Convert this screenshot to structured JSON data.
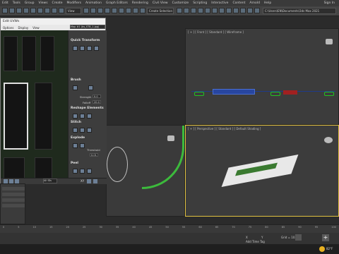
{
  "menu": [
    "Edit",
    "Tools",
    "Group",
    "Views",
    "Create",
    "Modifiers",
    "Animation",
    "Graph Editors",
    "Rendering",
    "Civil View",
    "Customize",
    "Scripting",
    "Interactive",
    "Content",
    "Arnold",
    "Help"
  ],
  "sign_in": "Sign In",
  "toolbar": {
    "view_select": "View",
    "selection_set": "Create Selection Se",
    "project_path": "C:\\Users\\EN\\Documents\\3ds Max 2021"
  },
  "viewports": {
    "front_label": "[ + ] [ Front ] [ Standard ] [ Wireframe ]",
    "perspective_label": "[ + ] [ Perspective ] [ Standard ] [ Default Shading ]"
  },
  "uv_editor": {
    "title": "Edit UVWs",
    "menu": [
      "Options",
      "Display",
      "View"
    ],
    "map_select": "Map #1 (bs_ST8_1.jpg)",
    "map_suffix": "UV",
    "panel": {
      "quick_transform": "Quick Transform",
      "brush": "Brush",
      "strength_label": "Strength",
      "strength_value": "0.0",
      "falloff_label": "Falloff",
      "falloff_value": "20.0",
      "reshape_elements": "Reshape Elements",
      "stitch": "Stitch",
      "explode": "Explode",
      "threshold_label": "Threshold",
      "threshold_value": "0.01",
      "peel": "Peel"
    },
    "bottom_zoom": "XY",
    "bottom_all": "All IDs",
    "bottom_value": "0.0"
  },
  "timeline": {
    "ticks": [
      "0",
      "5",
      "10",
      "15",
      "20",
      "25",
      "30",
      "35",
      "40",
      "45",
      "50",
      "55",
      "60",
      "65",
      "70",
      "75",
      "80",
      "85",
      "90",
      "95",
      "100"
    ]
  },
  "status": {
    "add_time_tag": "Add Time Tag",
    "grid": "Grid = 10.0",
    "x": "X",
    "y": "Y"
  },
  "taskbar": {
    "temp": "82°F"
  }
}
